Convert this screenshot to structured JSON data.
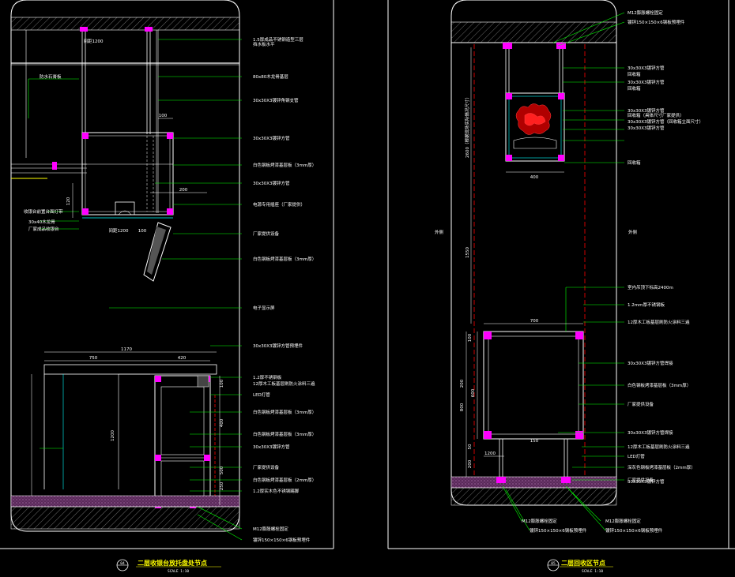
{
  "detail_a": {
    "badge": "04",
    "title": "二层收银台放托盘处节点",
    "scale": "SCALE 1:10",
    "labels": [
      "1.5厚成品不锈钢造型三层",
      "挡水板水平",
      "80x80木龙骨基层",
      "30x30X3镀锌角钢支管",
      "30x30X3镀锌方管",
      "白色钢板烤漆基层板（3mm厚）",
      "30x30X3镀锌方管",
      "电源专用插座（厂家提供）",
      "厂家提供设备",
      "白色钢板烤漆基层板（3mm厚）",
      "电子显示屏",
      "30x30X3镀锌方管预埋件",
      "1.2厚不锈钢板",
      "12厚木工板基层刷防火涂料三遍",
      "LED灯管",
      "白色钢板烤漆基层板（3mm厚）",
      "白色钢板烤漆基层板（3mm厚）",
      "30x30X3镀锌方管",
      "厂家提供设备",
      "白色钢板烤漆基层板（2mm厚）",
      "1.2厚实木色不锈钢踢脚",
      "M12膨胀螺栓固定",
      "镀锌150×150×6钢板预埋件"
    ],
    "left_labels": [
      "防水石膏板",
      "收银台前置台面灯带",
      "30x40木龙骨",
      "厂家成品收银台"
    ],
    "dims": [
      "间距1200",
      "100",
      "200",
      "间距1200",
      "120",
      "1170",
      "750",
      "420",
      "1200",
      "100",
      "400",
      "500",
      "250",
      "100"
    ]
  },
  "detail_b": {
    "badge": "05",
    "title": "二层回收区节点",
    "scale": "SCALE 1:10",
    "labels": [
      "M12膨胀螺栓固定",
      "镀锌150×150×6钢板预埋件",
      "30x30X3镀锌方管",
      "回收箱",
      "30x30X3镀锌方管",
      "回收箱",
      "30x30X3镀锌方管",
      "回收箱（具体尺寸厂家提供）",
      "30x30X3镀锌方管（回收箱立面尺寸）",
      "30x30X3镀锌方管",
      "回收箱",
      "室内吊顶下标高2400m",
      "1.2mm厚不锈钢板",
      "12厚木工板基层刷防火涂料三遍",
      "30x30X3镀锌方管焊接",
      "白色钢板烤漆基层板（3mm厚）",
      "厂家提供设备",
      "30x30X3镀锌方管焊接",
      "12厚木工板基层刷防火涂料三遍",
      "LED灯管",
      "深灰色钢板烤漆基层板（2mm厚）",
      "厂家提供设备",
      "30x30X3镀锌方管"
    ],
    "bottom_labels": [
      "M12膨胀螺栓固定",
      "镀锌150×150×6钢板预埋件",
      "M12膨胀螺栓固定",
      "镀锌150×150×6钢板预埋件"
    ],
    "side_labels": [
      "外侧",
      "外侧"
    ],
    "vertical_note": "2600（根据现场实际情况尺寸）",
    "dims": [
      "400",
      "700",
      "1550",
      "100",
      "200",
      "800",
      "600",
      "50",
      "200",
      "1200",
      "150"
    ]
  },
  "colors": {
    "background": "#000000",
    "frame": "#ffffff",
    "leader": "#00ff00",
    "structure": "#ffffff",
    "accent": "#ff00ff",
    "hidden": "#ff0000",
    "hatch": "#7a3a7a",
    "cyan": "#00ffff",
    "title": "#ffff00"
  }
}
